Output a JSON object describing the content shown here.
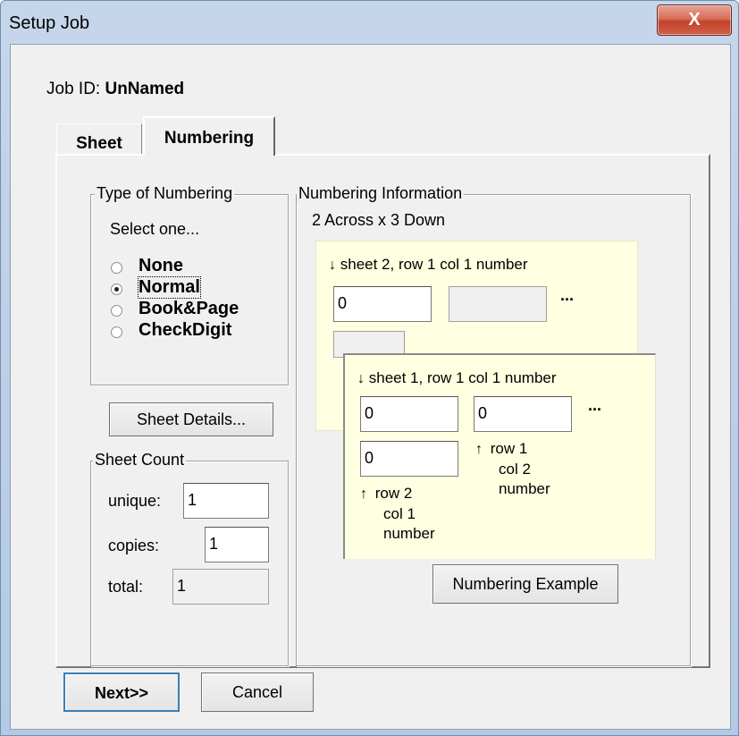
{
  "window": {
    "title": "Setup Job",
    "close_label": "X"
  },
  "job": {
    "label": "Job ID: ",
    "value": "UnNamed"
  },
  "tabs": [
    {
      "label": "Sheet",
      "selected": false
    },
    {
      "label": "Numbering",
      "selected": true
    }
  ],
  "type_group": {
    "legend": "Type of Numbering",
    "hint": "Select one...",
    "options": [
      {
        "label": "None",
        "selected": false
      },
      {
        "label": "Normal",
        "selected": true
      },
      {
        "label": "Book&Page",
        "selected": false
      },
      {
        "label": "CheckDigit",
        "selected": false
      }
    ]
  },
  "sheet_details_label": "Sheet Details...",
  "sheet_count": {
    "legend": "Sheet Count",
    "unique_label": "unique:",
    "unique_value": "1",
    "copies_label": "copies:",
    "copies_value": "1",
    "total_label": "total:",
    "total_value": "1"
  },
  "info": {
    "legend": "Numbering Information",
    "layout": "2 Across x 3 Down",
    "sheet2_caption": "sheet 2, row 1 col 1 number",
    "sheet2_value": "0",
    "sheet1_caption": "sheet 1, row 1 col 1 number",
    "sheet1_r1c1": "0",
    "sheet1_r1c2": "0",
    "sheet1_r2c1": "0",
    "ellipsis": "...",
    "row1_col2_label": [
      "row 1",
      "col 2",
      "number"
    ],
    "row2_col1_label": [
      "row 2",
      "col 1",
      "number"
    ],
    "example_button": "Numbering Example"
  },
  "buttons": {
    "next": "Next>>",
    "cancel": "Cancel"
  },
  "icons": {
    "down_arrow": "↓",
    "up_arrow": "↑"
  }
}
